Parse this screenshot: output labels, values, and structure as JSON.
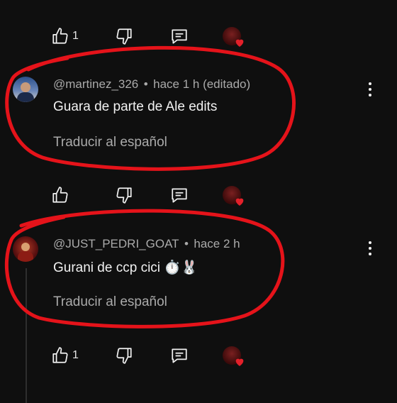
{
  "top_actions": {
    "like_count": "1"
  },
  "comments": [
    {
      "handle": "@martinez_326",
      "separator": "•",
      "time": "hace 1 h (editado)",
      "text": "Guara de parte de Ale edits",
      "translate_label": "Traducir al español",
      "like_count": ""
    },
    {
      "handle": "@JUST_PEDRI_GOAT",
      "separator": "•",
      "time": "hace 2 h",
      "text": "Gurani de ccp cici ⏱️🐰",
      "translate_label": "Traducir al español",
      "like_count": "1"
    }
  ],
  "colors": {
    "background": "#0f0f0f",
    "annotation": "#e5131a",
    "heart": "#e4202a"
  },
  "icons": [
    "thumbs-up-icon",
    "thumbs-down-icon",
    "reply-icon",
    "creator-heart-icon",
    "more-vert-icon"
  ]
}
